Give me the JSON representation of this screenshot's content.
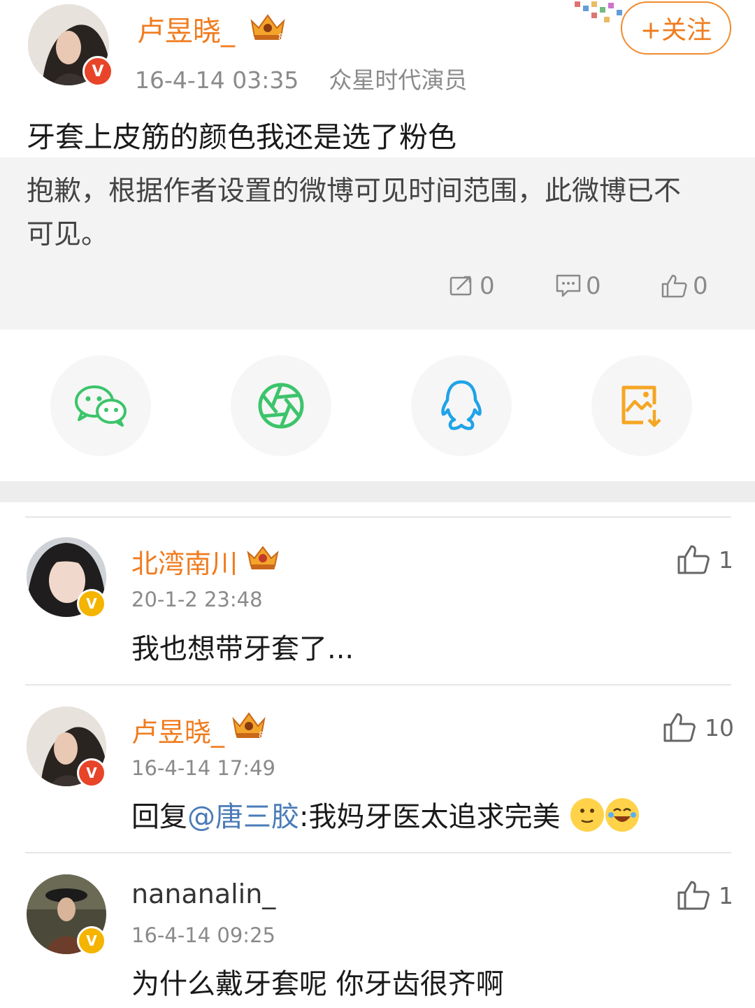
{
  "post": {
    "author": "卢昱晓_",
    "time": "16-4-14 03:35",
    "source": "众星时代演员",
    "follow_label": "+关注",
    "text": "牙套上皮筋的颜色我还是选了粉色",
    "quoted": {
      "notice_line1": "抱歉，根据作者设置的微博可见时间范围，此微博已不",
      "notice_line2": "可见。",
      "reposts": "0",
      "comments": "0",
      "likes": "0"
    }
  },
  "share": {
    "items": [
      {
        "name": "wechat-icon",
        "color": "#3cc46b"
      },
      {
        "name": "moments-icon",
        "color": "#3cc46b"
      },
      {
        "name": "qq-icon",
        "color": "#1fa3e8"
      },
      {
        "name": "save-image-icon",
        "color": "#f5a623"
      }
    ]
  },
  "comments": [
    {
      "author": "北湾南川",
      "time": "20-1-2 23:48",
      "text": "我也想带牙套了...",
      "likes": "1",
      "badge": "yellow"
    },
    {
      "author": "卢昱晓_",
      "time": "16-4-14 17:49",
      "text_prefix": "回复",
      "mention": "@唐三胶",
      "text_rest": ":我妈牙医太追求完美",
      "likes": "10",
      "badge": "red"
    },
    {
      "author": "nananalin_",
      "time": "16-4-14 09:25",
      "text": "为什么戴牙套呢 你牙齿很齐啊",
      "likes": "1",
      "badge": "yellow"
    }
  ],
  "colors": {
    "accent": "#f07b1d",
    "mention": "#4a7bb7",
    "badge_red": "#e8442a",
    "badge_yellow": "#f4b400"
  }
}
